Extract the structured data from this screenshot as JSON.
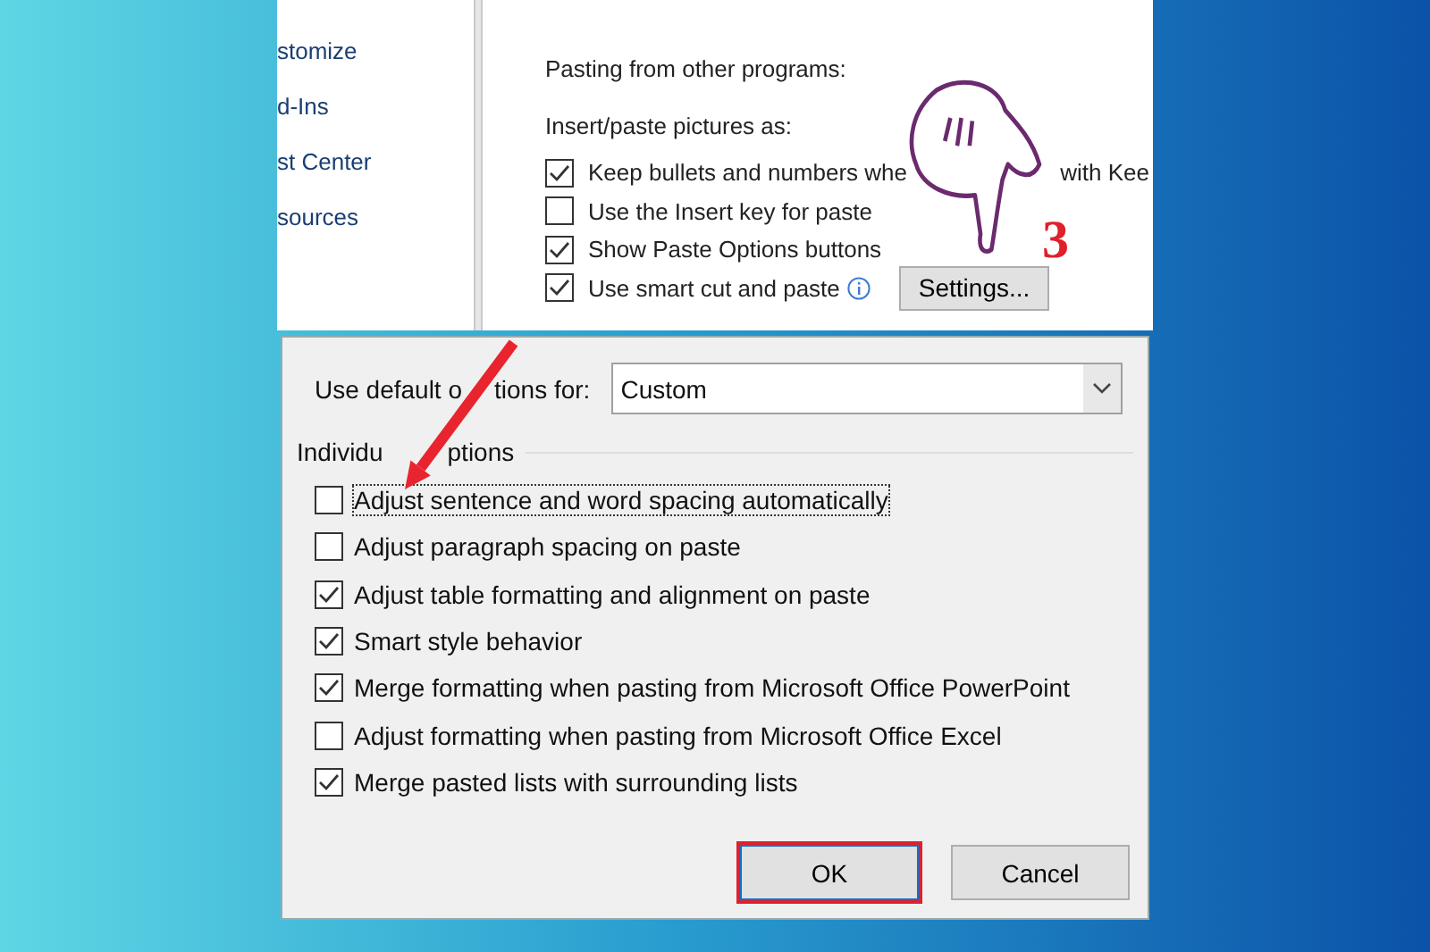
{
  "top_panel": {
    "sidebar_items": [
      "stomize",
      "d-Ins",
      "st Center",
      "sources"
    ],
    "section_title": "Pasting from other programs:",
    "picture_label": "Insert/paste pictures as:",
    "options": [
      {
        "label": "Keep bullets and numbers whe",
        "label_tail": "with Kee",
        "checked": true
      },
      {
        "label": "Use the Insert key for paste",
        "checked": false
      },
      {
        "label": "Show Paste Options buttons",
        "checked": true
      },
      {
        "label": "Use smart cut and paste",
        "checked": true,
        "info": true,
        "button": "Settings..."
      }
    ],
    "step_number": "3"
  },
  "dialog": {
    "default_label": "Use default o",
    "default_label_tail": "tions for:",
    "default_value": "Custom",
    "group_title": "Individu",
    "group_title_tail": "ptions",
    "options": [
      {
        "label": "Adjust sentence and word spacing automatically",
        "checked": false,
        "focused": true
      },
      {
        "label": "Adjust paragraph spacing on paste",
        "checked": false,
        "focused": false
      },
      {
        "label": "Adjust table formatting and alignment on paste",
        "checked": true,
        "focused": false
      },
      {
        "label": "Smart style behavior",
        "checked": true,
        "focused": false
      },
      {
        "label": "Merge formatting when pasting from Microsoft Office PowerPoint",
        "checked": true,
        "focused": false
      },
      {
        "label": "Adjust formatting when pasting from Microsoft Office Excel",
        "checked": false,
        "focused": false
      },
      {
        "label": "Merge pasted lists with surrounding lists",
        "checked": true,
        "focused": false
      }
    ],
    "buttons": [
      {
        "label": "OK",
        "highlighted": true
      },
      {
        "label": "Cancel",
        "highlighted": false
      }
    ]
  }
}
